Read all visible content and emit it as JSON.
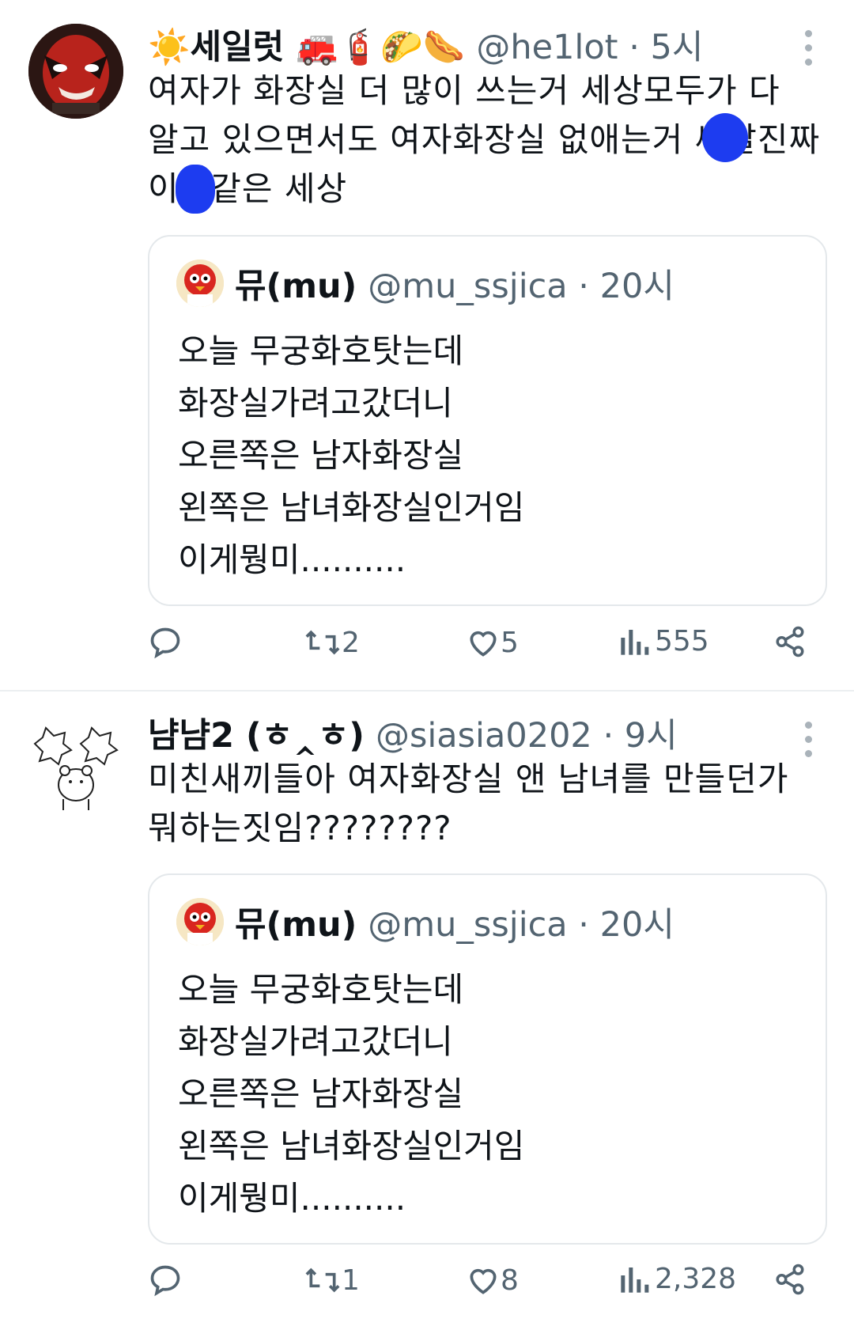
{
  "tweets": [
    {
      "name": "☀️세일럿 🚒🧯🌮🌭",
      "handle": "@he1lot · 5시",
      "lines": [
        "여자가 화장실 더 많이 쓰는거 세상모두가 다",
        "알고 있으면서도 여자화장실 없애는거 씨발진짜",
        "이딴같은 세상"
      ],
      "quote": {
        "name": "뮤(mu)",
        "handle": "@mu_ssjica · 20시",
        "lines": [
          "오늘 무궁화호탓는데",
          "화장실가려고갔더니",
          "오른쪽은 남자화장실",
          "왼쪽은 남녀화장실인거임",
          "이게뭥미.........."
        ]
      },
      "stats": {
        "replies": "",
        "retweets": "2",
        "likes": "5",
        "views": "555"
      }
    },
    {
      "name": "냠냠2 (ㅎ‸ㅎ)",
      "handle": "@siasia0202 · 9시",
      "lines": [
        "미친새끼들아 여자화장실 앤 남녀를 만들던가",
        "뭐하는짓임????????"
      ],
      "quote": {
        "name": "뮤(mu)",
        "handle": "@mu_ssjica · 20시",
        "lines": [
          "오늘 무궁화호탓는데",
          "화장실가려고갔더니",
          "오른쪽은 남자화장실",
          "왼쪽은 남녀화장실인거임",
          "이게뭥미.........."
        ]
      },
      "stats": {
        "replies": "",
        "retweets": "1",
        "likes": "8",
        "views": "2,328"
      }
    }
  ],
  "icons": [
    "reply-icon",
    "retweet-icon",
    "heart-icon",
    "views-icon",
    "share-icon",
    "more-icon"
  ],
  "colors": {
    "censor_blue": "#1d3cf0",
    "secondary_text": "#536471",
    "border": "#e4e8eb"
  }
}
